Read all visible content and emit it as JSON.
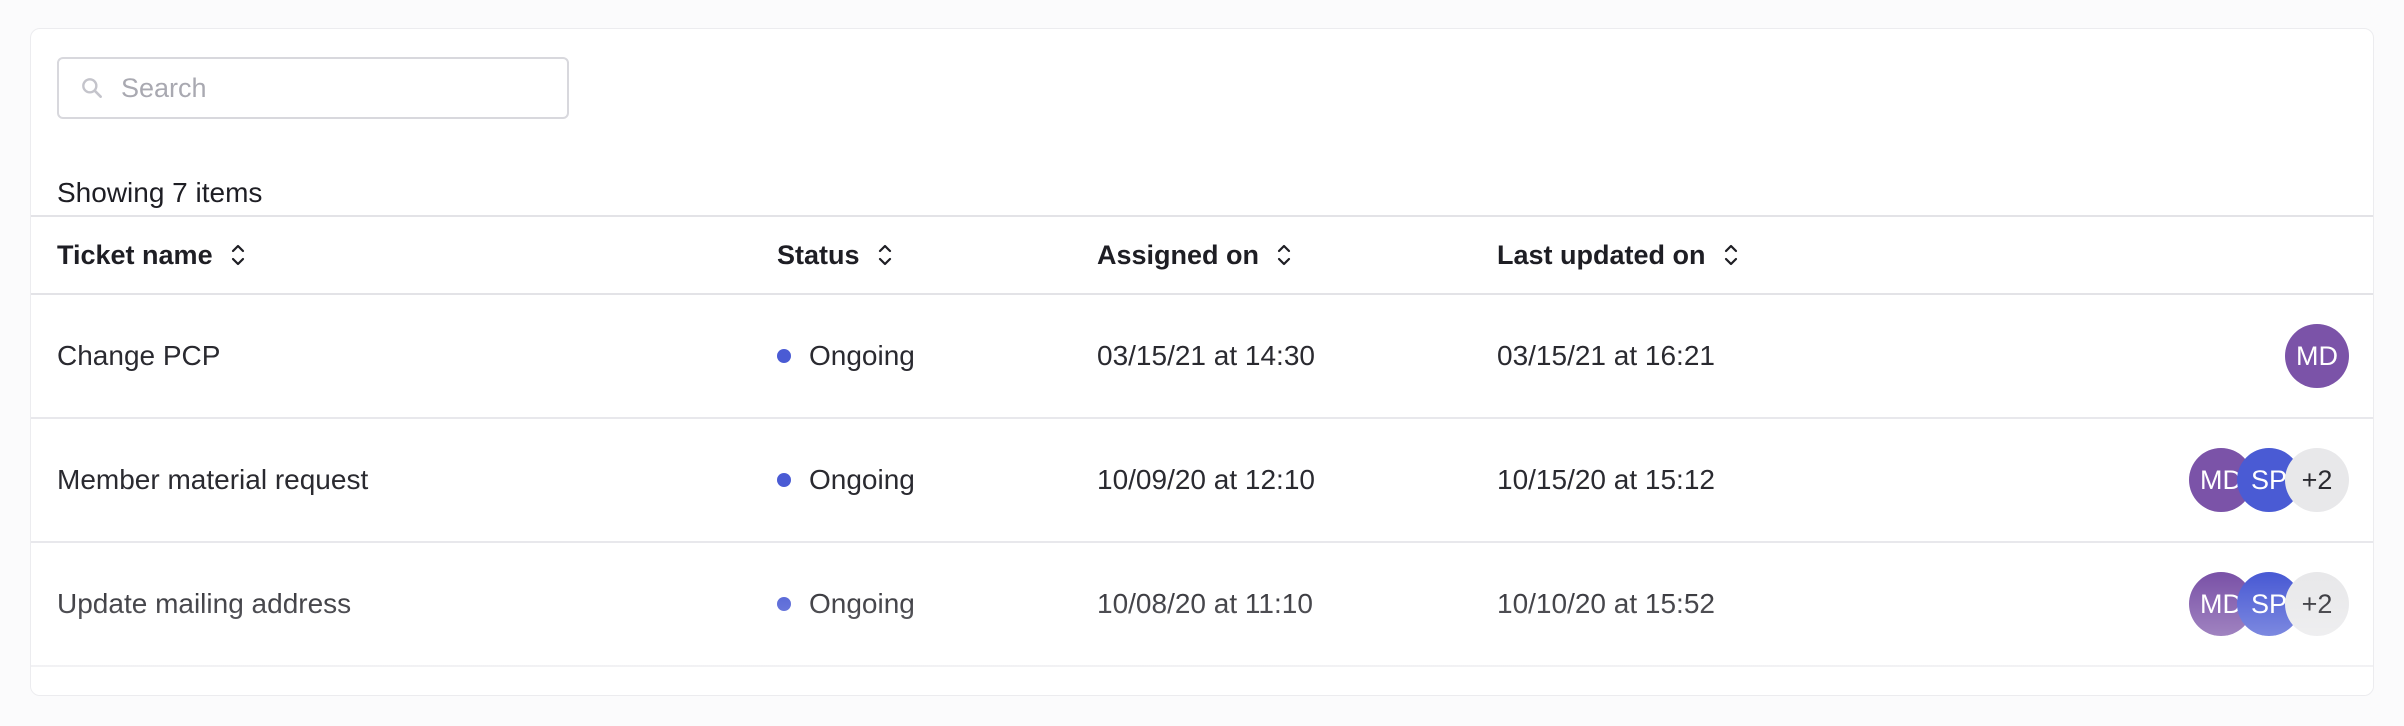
{
  "search": {
    "placeholder": "Search",
    "value": ""
  },
  "summary": {
    "text": "Showing 7 items"
  },
  "columns": [
    {
      "label": "Ticket name"
    },
    {
      "label": "Status"
    },
    {
      "label": "Assigned on"
    },
    {
      "label": "Last updated on"
    }
  ],
  "rows": [
    {
      "name": "Change PCP",
      "status": "Ongoing",
      "assigned": "03/15/21 at 14:30",
      "updated": "03/15/21 at 16:21",
      "avatars": [
        "MD"
      ]
    },
    {
      "name": "Member material request",
      "status": "Ongoing",
      "assigned": "10/09/20 at 12:10",
      "updated": "10/15/20 at 15:12",
      "avatars": [
        "MD",
        "SP"
      ],
      "more": "+2"
    },
    {
      "name": "Update mailing address",
      "status": "Ongoing",
      "assigned": "10/08/20 at 11:10",
      "updated": "10/10/20 at 15:52",
      "avatars": [
        "MD",
        "SP"
      ],
      "more": "+2"
    }
  ],
  "colors": {
    "status_ongoing": "#4a5bd4",
    "avatar_md": "#7b53a8",
    "avatar_sp": "#4a5bd4",
    "avatar_more": "#e8e8ea"
  },
  "icons": {
    "search": "search-icon",
    "sort": "sort-icon"
  }
}
